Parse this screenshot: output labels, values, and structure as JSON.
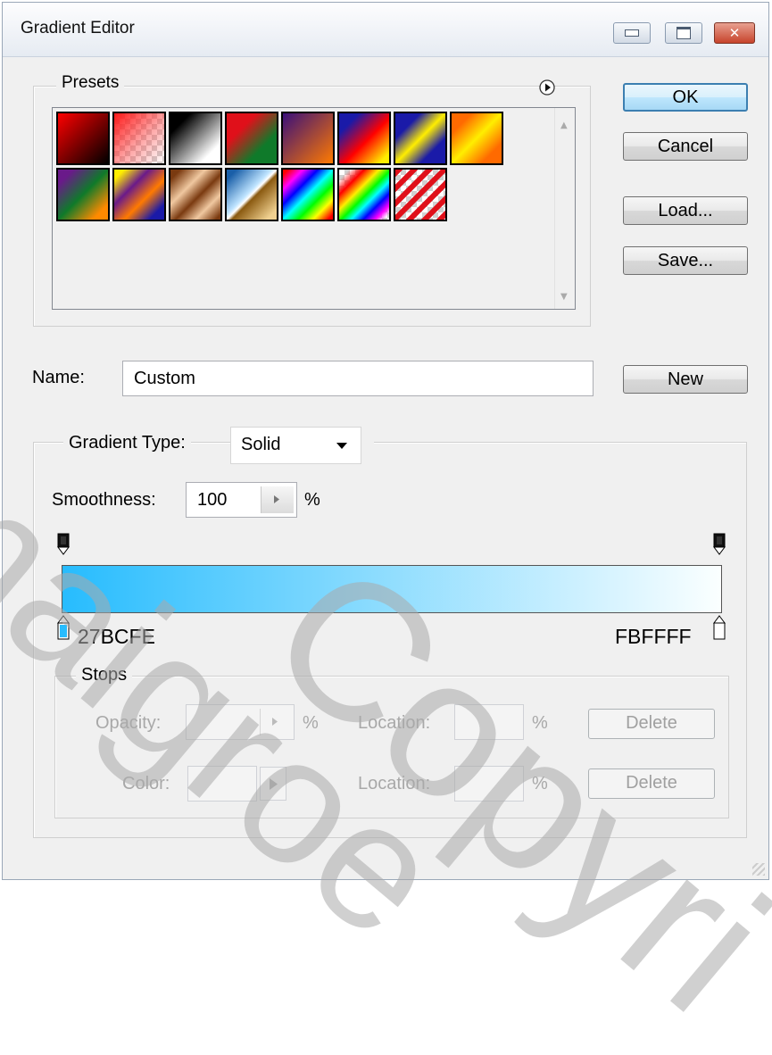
{
  "window": {
    "title": "Gradient Editor",
    "close_glyph": "✕"
  },
  "presets": {
    "group_label": "Presets",
    "menu_icon": "play-circle-icon",
    "swatches": [
      {
        "name": "red-black"
      },
      {
        "name": "red-transparent"
      },
      {
        "name": "black-white"
      },
      {
        "name": "red-green"
      },
      {
        "name": "violet-orange"
      },
      {
        "name": "blue-red-yellow"
      },
      {
        "name": "blue-yellow-blue"
      },
      {
        "name": "orange-yellow-orange"
      },
      {
        "name": "violet-green-orange"
      },
      {
        "name": "yellow-violet-orange-blue"
      },
      {
        "name": "copper"
      },
      {
        "name": "chrome"
      },
      {
        "name": "spectrum"
      },
      {
        "name": "transparent-rainbow"
      },
      {
        "name": "transparent-stripes"
      }
    ]
  },
  "buttons": {
    "ok": "OK",
    "cancel": "Cancel",
    "load": "Load...",
    "save": "Save...",
    "new": "New"
  },
  "name_field": {
    "label": "Name:",
    "value": "Custom"
  },
  "gradient": {
    "type_label": "Gradient Type:",
    "type_value": "Solid",
    "smoothness_label": "Smoothness:",
    "smoothness_value": "100",
    "smoothness_unit": "%",
    "start_color": "#27bcfe",
    "end_color": "#fbffff",
    "left_stop_label": "27BCFE",
    "right_stop_label": "FBFFFF"
  },
  "stops": {
    "group_label": "Stops",
    "opacity_label": "Opacity:",
    "opacity_unit": "%",
    "color_label": "Color:",
    "location_label": "Location:",
    "location_unit": "%",
    "delete_label": "Delete"
  },
  "watermark": {
    "text_1": "maigroe",
    "text_2": "Copyri"
  }
}
